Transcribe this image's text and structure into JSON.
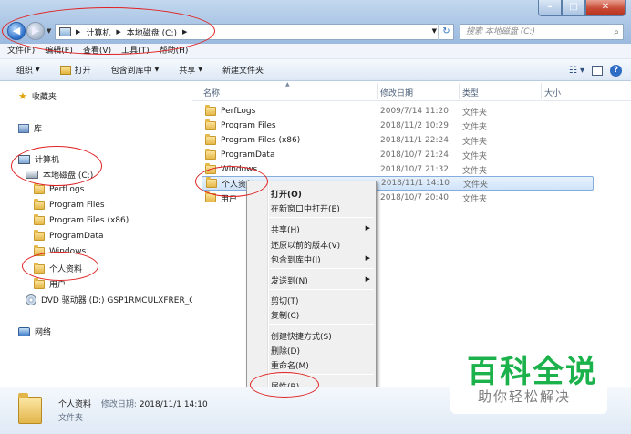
{
  "address": {
    "crumbs": [
      "计算机",
      "本地磁盘 (C:)"
    ],
    "search_placeholder": "搜索 本地磁盘 (C:)"
  },
  "menubar": [
    "文件(F)",
    "编辑(E)",
    "查看(V)",
    "工具(T)",
    "帮助(H)"
  ],
  "toolbar": {
    "organize": "组织",
    "open": "打开",
    "include": "包含到库中",
    "share": "共享",
    "new_folder": "新建文件夹"
  },
  "nav": {
    "favorites": "收藏夹",
    "library": "库",
    "computer": "计算机",
    "local_disk": "本地磁盘 (C:)",
    "folders": [
      "PerfLogs",
      "Program Files",
      "Program Files (x86)",
      "ProgramData",
      "Windows",
      "个人资料",
      "用户"
    ],
    "dvd": "DVD 驱动器 (D:) GSP1RMCULXFRER_C",
    "network": "网络"
  },
  "columns": {
    "name": "名称",
    "date": "修改日期",
    "type": "类型",
    "size": "大小"
  },
  "files": [
    {
      "name": "PerfLogs",
      "date": "2009/7/14 11:20",
      "type": "文件夹"
    },
    {
      "name": "Program Files",
      "date": "2018/11/2 10:29",
      "type": "文件夹"
    },
    {
      "name": "Program Files (x86)",
      "date": "2018/11/1 22:24",
      "type": "文件夹"
    },
    {
      "name": "ProgramData",
      "date": "2018/10/7 21:24",
      "type": "文件夹"
    },
    {
      "name": "Windows",
      "date": "2018/10/7 21:32",
      "type": "文件夹"
    },
    {
      "name": "个人资料",
      "date": "2018/11/1 14:10",
      "type": "文件夹"
    },
    {
      "name": "用户",
      "date": "2018/10/7 20:40",
      "type": "文件夹"
    }
  ],
  "context_menu": {
    "open": "打开(O)",
    "open_new_window": "在新窗口中打开(E)",
    "share": "共享(H)",
    "restore": "还原以前的版本(V)",
    "include": "包含到库中(I)",
    "send_to": "发送到(N)",
    "cut": "剪切(T)",
    "copy": "复制(C)",
    "shortcut": "创建快捷方式(S)",
    "delete": "删除(D)",
    "rename": "重命名(M)",
    "properties": "属性(R)"
  },
  "details": {
    "name": "个人资料",
    "modified_label": "修改日期:",
    "modified_value": "2018/11/1 14:10",
    "type": "文件夹"
  },
  "watermark": {
    "title": "百科全说",
    "subtitle": "助你轻松解决"
  },
  "colors": {
    "accent_green": "#1cb24b",
    "annotation_red": "#e02222",
    "selection": "#cfe3f9"
  }
}
